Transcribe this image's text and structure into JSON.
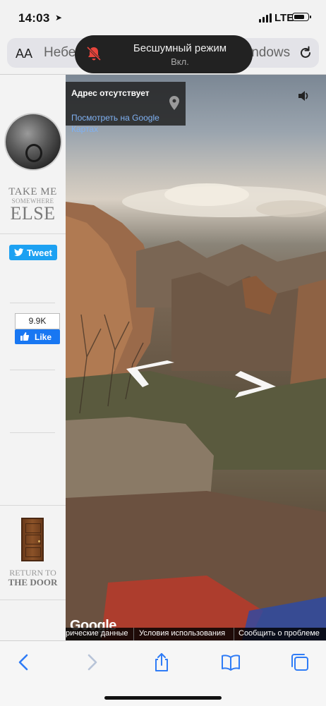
{
  "status_bar": {
    "time": "14:03",
    "network": "LTE"
  },
  "browser": {
    "text_size_label": "AA",
    "address_left": "Небе",
    "address_right": "indows"
  },
  "notification": {
    "title": "Бесшумный режим",
    "subtitle": "Вкл."
  },
  "sidebar": {
    "logo_line1": "TAKE ME",
    "logo_line2": "SOMEWHERE",
    "logo_line3": "ELSE",
    "tweet_label": "Tweet",
    "like_count": "9.9K",
    "like_label": "Like",
    "return_line1": "RETURN TO",
    "return_line2": "THE DOOR"
  },
  "street_view": {
    "info_title": "Адрес отсутствует",
    "info_link": "Посмотреть на Google Картах",
    "google_logo": "Google",
    "footer_1": "рические данные",
    "footer_2": "Условия использования",
    "footer_3": "Сообщить о проблеме"
  },
  "colors": {
    "tweet": "#1da1f2",
    "facebook": "#1877f2",
    "ios_blue": "#2f7cf6"
  },
  "icons": [
    "location-arrow-icon",
    "signal-icon",
    "battery-icon",
    "reload-icon",
    "bell-slash-icon",
    "twitter-bird-icon",
    "thumbs-up-icon",
    "map-pin-icon",
    "speaker-icon",
    "back-icon",
    "forward-icon",
    "share-icon",
    "bookmarks-icon",
    "tabs-icon"
  ]
}
